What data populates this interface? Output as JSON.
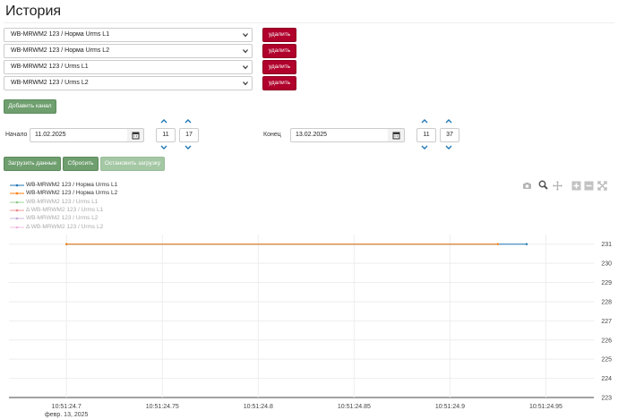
{
  "page": {
    "title": "История"
  },
  "channels": [
    {
      "value": "WB-MRWM2 123 / Норма Urms L1",
      "delete_label": "удалить"
    },
    {
      "value": "WB-MRWM2 123 / Норма Urms L2",
      "delete_label": "удалить"
    },
    {
      "value": "WB-MRWM2 123 / Urms L1",
      "delete_label": "удалить"
    },
    {
      "value": "WB-MRWM2 123 / Urms L2",
      "delete_label": "удалить"
    }
  ],
  "add_channel_label": "Добавить канал",
  "start": {
    "label": "Начало",
    "date": "11.02.2025",
    "hour": "11",
    "minute": "17"
  },
  "end": {
    "label": "Конец",
    "date": "13.02.2025",
    "hour": "11",
    "minute": "37"
  },
  "actions": {
    "load": "Загрузить данные",
    "reset": "Сбросить",
    "stop": "Остановить загрузку"
  },
  "colors": {
    "accent_green": "#6f9f6f",
    "danger": "#b0002b",
    "series_l1": "#1f77b4",
    "series_l2": "#ff7f0e"
  },
  "legend": [
    {
      "text": "WB-MRWM2 123 / Норма Urms L1",
      "color": "#1f77b4",
      "faded": false,
      "prefix": ""
    },
    {
      "text": "WB-MRWM2 123 / Норма Urms L2",
      "color": "#ff7f0e",
      "faded": false,
      "prefix": ""
    },
    {
      "text": "WB-MRWM2 123 / Urms L1",
      "color": "#2ca02c",
      "faded": true,
      "prefix": ""
    },
    {
      "text": "WB-MRWM2 123 / Urms L1",
      "color": "#d62728",
      "faded": true,
      "prefix": "Δ "
    },
    {
      "text": "WB-MRWM2 123 / Urms L2",
      "color": "#9467bd",
      "faded": true,
      "prefix": ""
    },
    {
      "text": "WB-MRWM2 123 / Urms L2",
      "color": "#e377c2",
      "faded": true,
      "prefix": "Δ "
    }
  ],
  "modebar_icons": [
    "camera-icon",
    "zoom-icon",
    "pan-icon",
    "zoom-in-icon",
    "zoom-out-icon",
    "autoscale-icon"
  ],
  "chart_data": {
    "type": "line",
    "x_ticks": [
      "10:51:24.7",
      "10:51:24.75",
      "10:51:24.8",
      "10:51:24.85",
      "10:51:24.9",
      "10:51:24.95"
    ],
    "x_tick_values": [
      24.7,
      24.75,
      24.8,
      24.85,
      24.9,
      24.95
    ],
    "x_sublabel": "февр. 13, 2025",
    "xlim": [
      24.67,
      24.975
    ],
    "ylim": [
      223,
      231.5
    ],
    "y_ticks": [
      223,
      224,
      225,
      226,
      227,
      228,
      229,
      230,
      231
    ],
    "grid": true,
    "series": [
      {
        "name": "WB-MRWM2 123 / Норма Urms L1",
        "color": "#1f77b4",
        "x": [
          24.7,
          24.94
        ],
        "y": [
          231,
          231
        ]
      },
      {
        "name": "WB-MRWM2 123 / Норма Urms L2",
        "color": "#ff7f0e",
        "x": [
          24.7,
          24.925
        ],
        "y": [
          231,
          231
        ]
      }
    ]
  }
}
